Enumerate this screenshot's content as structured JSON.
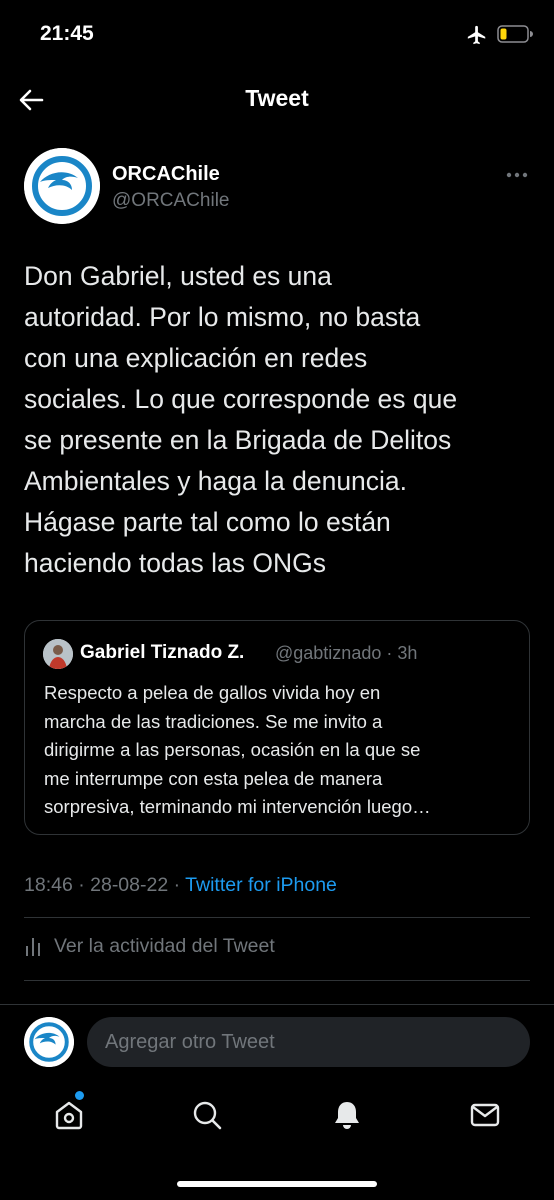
{
  "status_bar": {
    "time": "21:45",
    "icons": [
      "airplane-icon",
      "battery-icon"
    ],
    "battery_color": "#ffd60a"
  },
  "header": {
    "title": "Tweet",
    "back_icon": "back-arrow-icon"
  },
  "tweet": {
    "author_name": "ORCAChile",
    "author_handle": "@ORCAChile",
    "text": "Don Gabriel, usted es una\nautoridad. Por lo mismo, no basta\ncon una explicación en redes\nsociales. Lo que corresponde es que\nse presente en la Brigada de Delitos\nAmbientales y haga la denuncia.\nHágase parte tal como lo están\nhaciendo todas las ONGs",
    "quote": {
      "author_name": "Gabriel Tiznado Z.",
      "meta": "@gabtiznado · 3h",
      "text": "Respecto a pelea de gallos vivida hoy en\nmarcha de las tradiciones. Se me invito a\ndirigirme a las personas, ocasión en la que se\nme interrumpe con esta pelea de manera\nsorpresiva, terminando mi intervención luego…"
    },
    "timestamp": "18:46 · 28-08-22 · ",
    "source": "Twitter for iPhone",
    "activity_label": "Ver la actividad del Tweet"
  },
  "reply": {
    "placeholder": "Agregar otro Tweet"
  },
  "tab_bar": {
    "tabs": [
      "home-icon",
      "search-icon",
      "notifications-icon",
      "messages-icon"
    ]
  },
  "colors": {
    "background": "#000000",
    "text": "#e7e9ea",
    "muted": "#71767b",
    "accent": "#1d9bf0",
    "border": "#2f3336"
  }
}
